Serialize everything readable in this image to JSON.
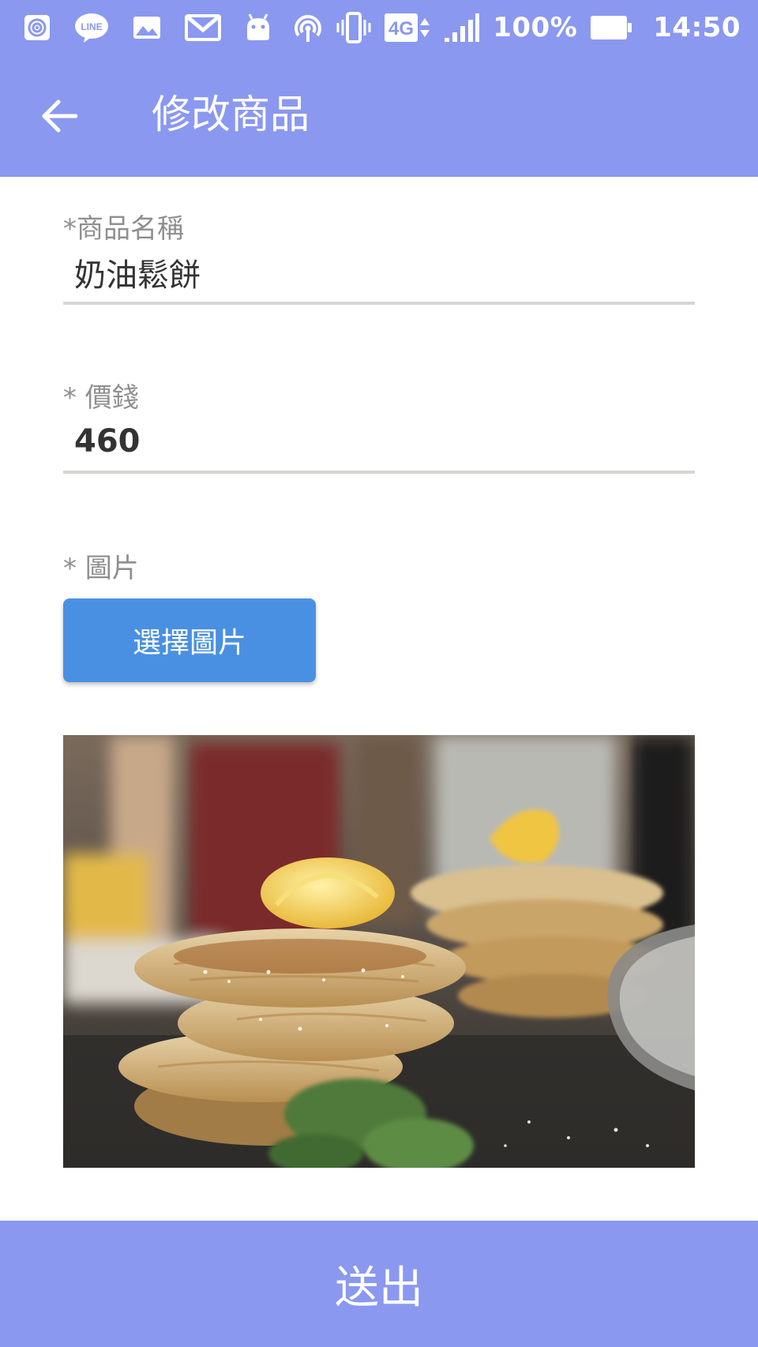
{
  "status_bar": {
    "icons": [
      "hotspot-icon",
      "line-app-icon",
      "gallery-icon",
      "gmail-icon",
      "android-icon",
      "wifi-hotspot-icon",
      "vibrate-icon",
      "signal-4g-icon",
      "cell-signal-icon",
      "battery-icon"
    ],
    "network_label": "4G",
    "battery_text": "100%",
    "time": "14:50"
  },
  "app_bar": {
    "back_icon": "arrow-left-icon",
    "title": "修改商品"
  },
  "form": {
    "name_label": "*商品名稱",
    "name_value": "奶油鬆餅",
    "price_label": "* 價錢",
    "price_value": "460",
    "image_label": "* 圖片",
    "select_image_button": "選擇圖片"
  },
  "submit_button": "送出",
  "colors": {
    "primary": "#8a98f0",
    "button_blue": "#4a90e2",
    "label_gray": "#8f8f8f",
    "underline": "#d6d6d0",
    "text": "#333333"
  }
}
